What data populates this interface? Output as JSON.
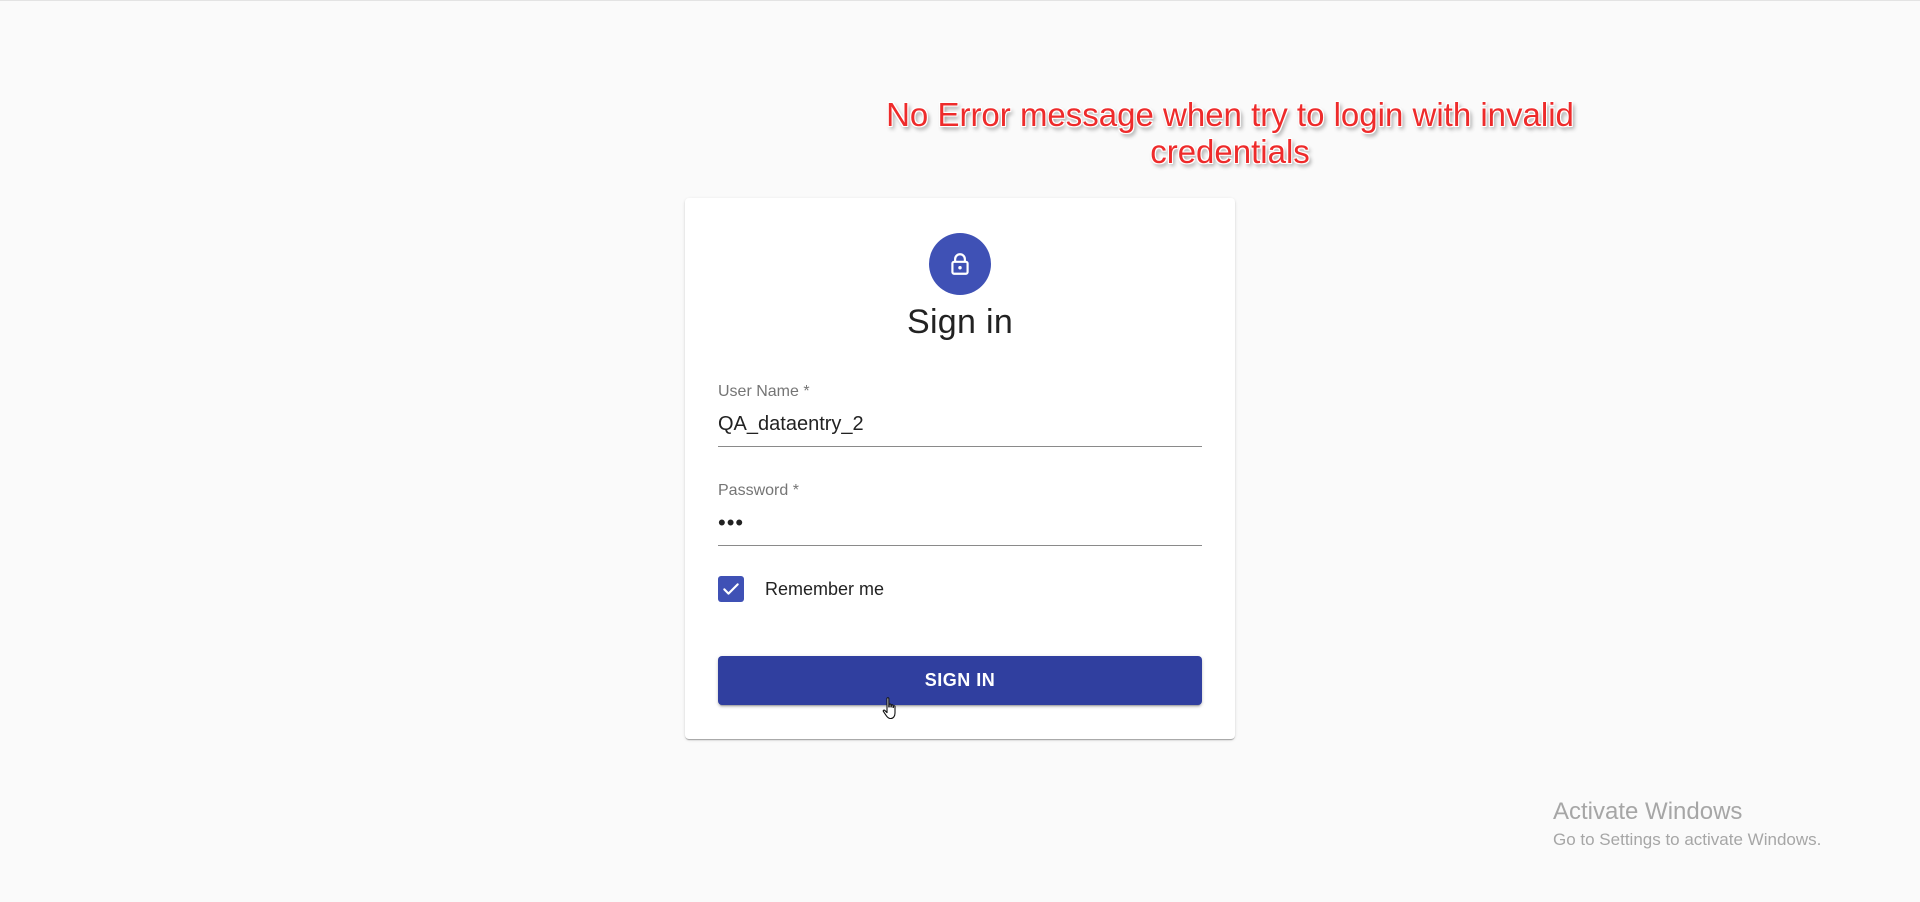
{
  "annotation": {
    "line1": "No Error message when try to login with invalid",
    "line2": "credentials",
    "color": "#ee2b2b"
  },
  "login": {
    "title": "Sign in",
    "avatar_icon": "lock-icon",
    "username_label": "User Name *",
    "username_value": "QA_dataentry_2",
    "password_label": "Password *",
    "password_value": "•••",
    "remember_label": "Remember me",
    "remember_checked": true,
    "submit_label": "SIGN IN",
    "accent_color": "#3f51b5",
    "button_color": "#303f9f"
  },
  "watermark": {
    "title": "Activate Windows",
    "subtitle": "Go to Settings to activate Windows."
  }
}
